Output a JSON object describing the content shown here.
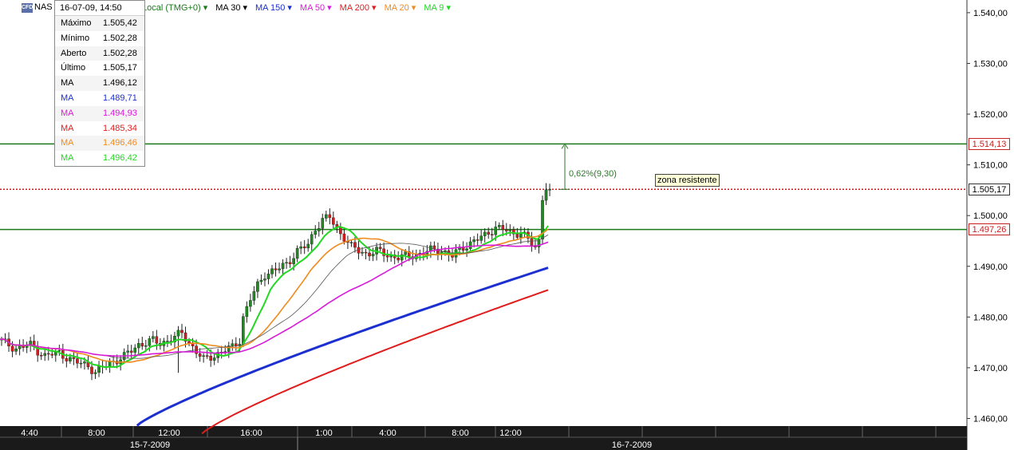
{
  "header": {
    "logo": "CFD",
    "symbol": "NAS",
    "legend": [
      {
        "label": "Local (TMG+0)",
        "color": "#1a7a1a"
      },
      {
        "label": "MA 30",
        "color": "#000000"
      },
      {
        "label": "MA 150",
        "color": "#1c2fd0"
      },
      {
        "label": "MA 50",
        "color": "#d81ad8"
      },
      {
        "label": "MA 200",
        "color": "#e01c1c"
      },
      {
        "label": "MA 20",
        "color": "#f08a1c"
      },
      {
        "label": "MA 9",
        "color": "#22d822"
      }
    ],
    "legend_arrow": "▾"
  },
  "infobox": {
    "datetime": "16-07-09, 14:50",
    "rows": [
      {
        "label": "Máximo",
        "value": "1.505,42",
        "color": "#000000"
      },
      {
        "label": "Mínimo",
        "value": "1.502,28",
        "color": "#000000"
      },
      {
        "label": "Aberto",
        "value": "1.502,28",
        "color": "#000000"
      },
      {
        "label": "Último",
        "value": "1.505,17",
        "color": "#000000"
      },
      {
        "label": "MA",
        "value": "1.496,12",
        "color": "#000000"
      },
      {
        "label": "MA",
        "value": "1.489,71",
        "color": "#1c2fd0"
      },
      {
        "label": "MA",
        "value": "1.494,93",
        "color": "#d81ad8"
      },
      {
        "label": "MA",
        "value": "1.485,34",
        "color": "#e01c1c"
      },
      {
        "label": "MA",
        "value": "1.496,46",
        "color": "#f08a1c"
      },
      {
        "label": "MA",
        "value": "1.496,42",
        "color": "#22d822"
      }
    ]
  },
  "annotations": {
    "percent_change": "0,62%(9,30)",
    "zone_label": "zona resistente"
  },
  "chart_data": {
    "type": "candlestick",
    "instrument": "NAS",
    "ylim": [
      1458.5,
      1542.5
    ],
    "y_ticks": [
      1540,
      1530,
      1520,
      1510,
      1500,
      1490,
      1480,
      1470,
      1460
    ],
    "y_tick_labels": [
      "1.540,00",
      "1.530,00",
      "1.520,00",
      "1.510,00",
      "1.500,00",
      "1.490,00",
      "1.480,00",
      "1.470,00",
      "1.460,00"
    ],
    "x_time_labels": [
      "4:40",
      "8:00",
      "12:00",
      "16:00",
      "1:00",
      "4:00",
      "8:00",
      "12:00"
    ],
    "x_date_labels": [
      "15-7-2009",
      "16-7-2009"
    ],
    "grid": "vertical-only",
    "horizontal_lines": [
      {
        "label": "1.514,13",
        "value": 1514.13,
        "color": "#1a7a1a",
        "style": "solid"
      },
      {
        "label": "1.505,17",
        "value": 1505.17,
        "color": "#d01c1c",
        "style": "dotted"
      },
      {
        "label": "1.497,26",
        "value": 1497.26,
        "color": "#1a7a1a",
        "style": "solid"
      }
    ],
    "moving_averages": [
      {
        "name": "MA 9",
        "color": "#22d822",
        "last": 1496.42
      },
      {
        "name": "MA 20",
        "color": "#f08a1c",
        "last": 1496.46
      },
      {
        "name": "MA 30",
        "color": "#555555",
        "last": 1496.12
      },
      {
        "name": "MA 50",
        "color": "#d81ad8",
        "last": 1494.93
      },
      {
        "name": "MA 150",
        "color": "#1c2fd0",
        "last": 1489.71
      },
      {
        "name": "MA 200",
        "color": "#e01c1c",
        "last": 1485.34
      }
    ],
    "close_path": [
      [
        0,
        1475.2
      ],
      [
        4,
        1473.8
      ],
      [
        8,
        1474.5
      ],
      [
        12,
        1472.3
      ],
      [
        16,
        1473.0
      ],
      [
        20,
        1471.2
      ],
      [
        24,
        1470.5
      ],
      [
        26,
        1469.0
      ],
      [
        30,
        1471.0
      ],
      [
        34,
        1472.2
      ],
      [
        38,
        1474.6
      ],
      [
        42,
        1475.3
      ],
      [
        44,
        1474.8
      ],
      [
        48,
        1476.0
      ],
      [
        50,
        1476.8
      ],
      [
        54,
        1473.2
      ],
      [
        56,
        1471.5
      ],
      [
        60,
        1472.8
      ],
      [
        62,
        1473.5
      ],
      [
        64,
        1474.0
      ],
      [
        66,
        1475.5
      ],
      [
        67,
        1480.0
      ],
      [
        69,
        1483.5
      ],
      [
        71,
        1486.2
      ],
      [
        73,
        1488.5
      ],
      [
        76,
        1489.2
      ],
      [
        79,
        1490.5
      ],
      [
        82,
        1493.0
      ],
      [
        85,
        1494.2
      ],
      [
        87,
        1497.5
      ],
      [
        89,
        1499.2
      ],
      [
        91,
        1499.6
      ],
      [
        93,
        1497.3
      ],
      [
        95,
        1495.8
      ],
      [
        97,
        1493.8
      ],
      [
        99,
        1493.0
      ],
      [
        101,
        1492.5
      ],
      [
        104,
        1493.0
      ],
      [
        107,
        1492.2
      ],
      [
        110,
        1491.8
      ],
      [
        113,
        1492.0
      ],
      [
        116,
        1492.5
      ],
      [
        119,
        1493.1
      ],
      [
        122,
        1493.2
      ],
      [
        125,
        1492.0
      ],
      [
        128,
        1493.8
      ],
      [
        131,
        1495.0
      ],
      [
        134,
        1496.0
      ],
      [
        137,
        1497.8
      ],
      [
        140,
        1497.0
      ],
      [
        142,
        1496.3
      ],
      [
        144,
        1497.0
      ],
      [
        146,
        1495.2
      ],
      [
        148,
        1493.5
      ],
      [
        149,
        1495.0
      ],
      [
        150,
        1503.0
      ],
      [
        151,
        1505.1
      ],
      [
        152,
        1505.17
      ]
    ]
  },
  "axis_labels": {
    "right": [
      {
        "text": "1.540,00",
        "value": 1540
      },
      {
        "text": "1.530,00",
        "value": 1530
      },
      {
        "text": "1.520,00",
        "value": 1520
      },
      {
        "text": "1.510,00",
        "value": 1510
      },
      {
        "text": "1.500,00",
        "value": 1500
      },
      {
        "text": "1.490,00",
        "value": 1490
      },
      {
        "text": "1.480,00",
        "value": 1480
      },
      {
        "text": "1.470,00",
        "value": 1470
      },
      {
        "text": "1.460,00",
        "value": 1460
      }
    ]
  }
}
